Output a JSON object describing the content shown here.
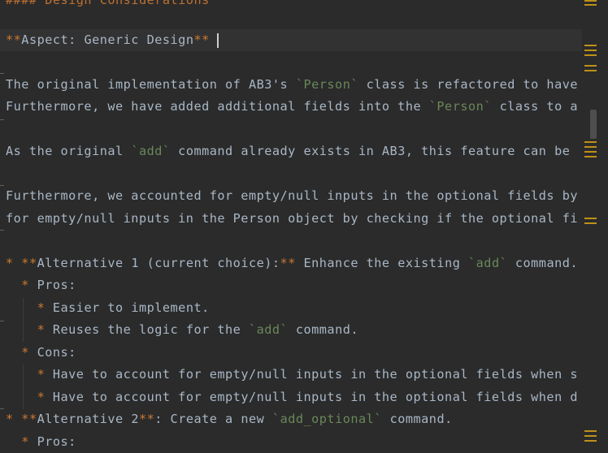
{
  "editor": {
    "lines": [
      {
        "segments": [
          {
            "t": "#### Design Considerations",
            "c": "mk-dim"
          }
        ]
      },
      {
        "segments": [
          {
            "t": "**",
            "c": "mk"
          },
          {
            "t": "Aspect: Generic Design",
            "c": ""
          },
          {
            "t": "**",
            "c": "mk"
          }
        ]
      },
      {
        "segments": [
          {
            "t": "The original implementation of AB3's ",
            "c": ""
          },
          {
            "t": "`Person`",
            "c": "code"
          },
          {
            "t": " class is refactored to have",
            "c": ""
          }
        ]
      },
      {
        "segments": [
          {
            "t": "Furthermore, we have added additional fields into the ",
            "c": ""
          },
          {
            "t": "`Person`",
            "c": "code"
          },
          {
            "t": " class to a",
            "c": ""
          }
        ]
      },
      {
        "segments": [
          {
            "t": "As the original ",
            "c": ""
          },
          {
            "t": "`add`",
            "c": "code"
          },
          {
            "t": " command already exists in AB3, this feature can be",
            "c": ""
          }
        ]
      },
      {
        "segments": [
          {
            "t": "Furthermore, we accounted for empty/null inputs in the optional fields by",
            "c": ""
          }
        ]
      },
      {
        "segments": [
          {
            "t": "for empty/null inputs in the Person object by checking if the optional fi",
            "c": ""
          }
        ]
      },
      {
        "segments": [
          {
            "t": "* ",
            "c": "mk"
          },
          {
            "t": "**",
            "c": "mk"
          },
          {
            "t": "Alternative 1 (current choice):",
            "c": ""
          },
          {
            "t": "**",
            "c": "mk"
          },
          {
            "t": " Enhance the existing ",
            "c": ""
          },
          {
            "t": "`add`",
            "c": "code"
          },
          {
            "t": " command.",
            "c": ""
          }
        ]
      },
      {
        "segments": [
          {
            "t": "  ",
            "c": ""
          },
          {
            "t": "*",
            "c": "mk"
          },
          {
            "t": " Pros:",
            "c": ""
          }
        ]
      },
      {
        "segments": [
          {
            "t": "    ",
            "c": ""
          },
          {
            "t": "*",
            "c": "mk"
          },
          {
            "t": " Easier to implement.",
            "c": ""
          }
        ]
      },
      {
        "segments": [
          {
            "t": "    ",
            "c": ""
          },
          {
            "t": "*",
            "c": "mk"
          },
          {
            "t": " Reuses the logic for the ",
            "c": ""
          },
          {
            "t": "`add`",
            "c": "code"
          },
          {
            "t": " command.",
            "c": ""
          }
        ]
      },
      {
        "segments": [
          {
            "t": "  ",
            "c": ""
          },
          {
            "t": "*",
            "c": "mk"
          },
          {
            "t": " Cons:",
            "c": ""
          }
        ]
      },
      {
        "segments": [
          {
            "t": "    ",
            "c": ""
          },
          {
            "t": "*",
            "c": "mk"
          },
          {
            "t": " Have to account for empty/null inputs in the optional fields when s",
            "c": ""
          }
        ]
      },
      {
        "segments": [
          {
            "t": "    ",
            "c": ""
          },
          {
            "t": "*",
            "c": "mk"
          },
          {
            "t": " Have to account for empty/null inputs in the optional fields when d",
            "c": ""
          }
        ]
      },
      {
        "segments": [
          {
            "t": "* ",
            "c": "mk"
          },
          {
            "t": "**",
            "c": "mk"
          },
          {
            "t": "Alternative 2",
            "c": ""
          },
          {
            "t": "**",
            "c": "mk"
          },
          {
            "t": ": Create a new ",
            "c": ""
          },
          {
            "t": "`add_optional`",
            "c": "code"
          },
          {
            "t": " command.",
            "c": ""
          }
        ]
      },
      {
        "segments": [
          {
            "t": "  ",
            "c": ""
          },
          {
            "t": "*",
            "c": "mk"
          },
          {
            "t": " Pros:",
            "c": ""
          }
        ]
      }
    ]
  },
  "colors": {
    "background": "#2b2b2b",
    "text": "#a9b7c6",
    "markup": "#cc7832",
    "inline_code": "#6a8759",
    "current_line": "#323232",
    "stripe": "#be9117"
  }
}
